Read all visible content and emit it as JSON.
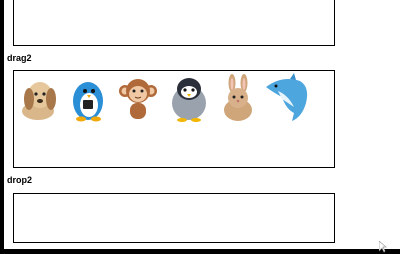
{
  "sections": {
    "drag2_label": "drag2",
    "drop2_label": "drop2"
  },
  "draggables": [
    {
      "name": "dog",
      "icon": "dog-icon"
    },
    {
      "name": "blue-penguin",
      "icon": "blue-penguin-icon"
    },
    {
      "name": "monkey",
      "icon": "monkey-icon"
    },
    {
      "name": "penguin",
      "icon": "penguin-icon"
    },
    {
      "name": "rabbit",
      "icon": "rabbit-icon"
    },
    {
      "name": "dolphin",
      "icon": "dolphin-icon"
    }
  ],
  "colors": {
    "border": "#000000",
    "background": "#ffffff",
    "dog": "#d9b78a",
    "blue_penguin": "#2a8fd6",
    "monkey": "#b06a3a",
    "penguin": "#2b2f3a",
    "rabbit": "#cfa57a",
    "dolphin": "#4ea6de"
  }
}
